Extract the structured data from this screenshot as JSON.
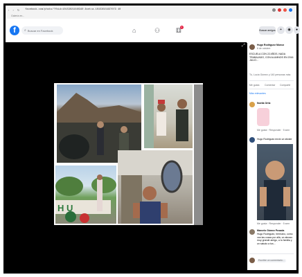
{
  "browser": {
    "url": "facebook.com/photo/?fbid=10153021840340 &set=a.10153021837073 40",
    "bookmarks": "Galería en..."
  },
  "fb_header": {
    "logo": "f",
    "search_placeholder": "Buscar en Facebook",
    "notification_count": "2",
    "find_friends_label": "Buscar amigos",
    "add_label": "+"
  },
  "sidebar": {
    "author_name": "Hugo Rodriguez Munoz",
    "post_date": "6 de octubre",
    "caption": "ESCUELA CON 22 AÑOS, NADA TRABAJADO, CON ALUMNOS EN 2016 JULIO...",
    "reactions_summary": "Tú, Lucía Gómez y 140 personas más",
    "comments_count": "22 comentarios",
    "like_label": "Me gusta",
    "comment_label": "Comentar",
    "share_label": "Compartir",
    "relevance_label": "Más relevantes",
    "comment1_name": "Noelia Ortiz",
    "comment_actions": "Me gusta · Responder · 5 sem",
    "comment2_author": "Hugo Rodriguez envió un sticker",
    "comment3_name": "Marcelo Gómez Posada",
    "comment3_text": "Hugo Rodriguez, hermano, como van las cosas por allá, un abrazo muy grande amigo, a tu familia y un saludo a tus...",
    "input_placeholder": "Escribe un comentario..."
  },
  "colors": {
    "fb_blue": "#1877f2",
    "dark_bg": "#000000",
    "badge_red": "#e41e3f"
  }
}
